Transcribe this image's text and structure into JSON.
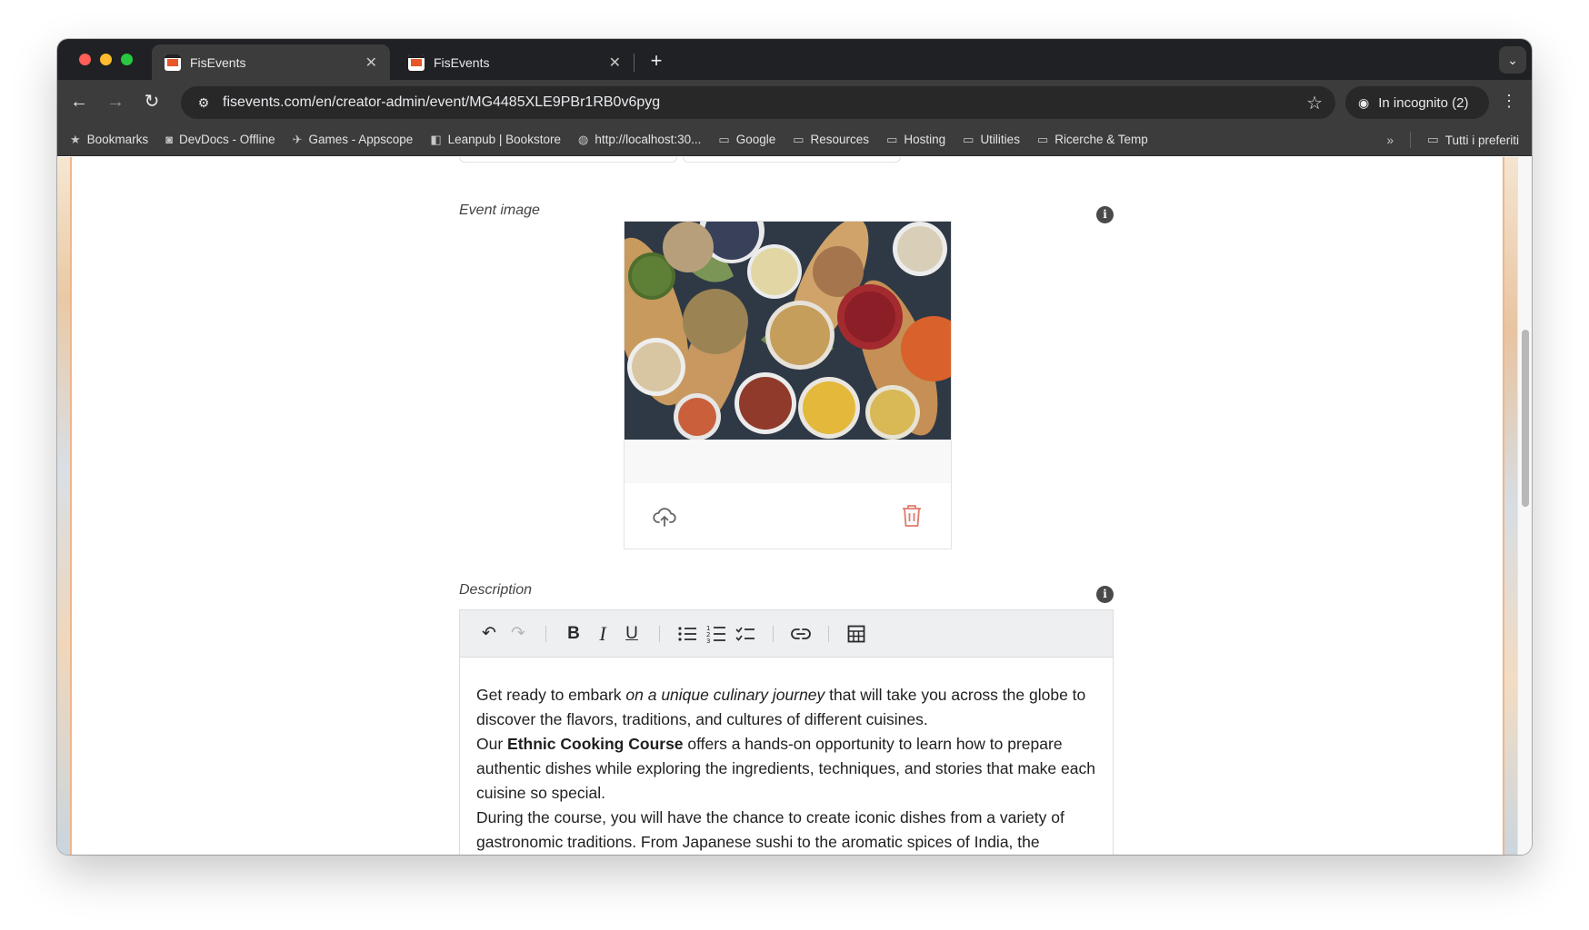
{
  "browser": {
    "tabs": [
      {
        "title": "FisEvents",
        "close": "✕"
      },
      {
        "title": "FisEvents",
        "close": "✕"
      }
    ],
    "new_tab": "+",
    "tab_menu": "⌄",
    "url": "fisevents.com/en/creator-admin/event/MG4485XLE9PBr1RB0v6pyg",
    "incognito_label": "In incognito (2)",
    "bookmarks": [
      {
        "icon": "star-icon",
        "glyph": "★",
        "label": "Bookmarks"
      },
      {
        "icon": "devdocs-icon",
        "glyph": "◙",
        "label": "DevDocs - Offline"
      },
      {
        "icon": "appscope-icon",
        "glyph": "✈",
        "label": "Games - Appscope"
      },
      {
        "icon": "leanpub-icon",
        "glyph": "◧",
        "label": "Leanpub | Bookstore"
      },
      {
        "icon": "globe-icon",
        "glyph": "◍",
        "label": "http://localhost:30..."
      },
      {
        "icon": "folder-icon",
        "glyph": "▭",
        "label": "Google"
      },
      {
        "icon": "folder-icon",
        "glyph": "▭",
        "label": "Resources"
      },
      {
        "icon": "folder-icon",
        "glyph": "▭",
        "label": "Hosting"
      },
      {
        "icon": "folder-icon",
        "glyph": "▭",
        "label": "Utilities"
      },
      {
        "icon": "folder-icon",
        "glyph": "▭",
        "label": "Ricerche & Temp"
      }
    ],
    "bookmarks_overflow": "»",
    "all_bookmarks": "Tutti i preferiti"
  },
  "page": {
    "event_image_label": "Event image",
    "description_label": "Description",
    "info_glyph": "i",
    "description": {
      "p1_a": "Get ready to embark ",
      "p1_em": "on a unique culinary journey",
      "p1_b": " that will take you across the globe to discover the flavors, traditions, and cultures of different cuisines.",
      "p2_a": "Our ",
      "p2_strong": "Ethnic Cooking Course",
      "p2_b": " offers a hands-on opportunity to learn how to prepare authentic dishes while exploring the ingredients, techniques, and stories that make each cuisine so special.",
      "p3": "During the course, you will have the chance to create iconic dishes from a variety of gastronomic traditions. From Japanese sushi to the aromatic spices of India, the"
    },
    "toolbar": {
      "undo": "↶",
      "redo": "↷",
      "bold": "B",
      "italic": "I",
      "underline": "U"
    }
  },
  "colors": {
    "accent_delete": "#e07a6e",
    "chrome_dark": "#202124",
    "chrome_toolbar": "#3c3c3c"
  }
}
